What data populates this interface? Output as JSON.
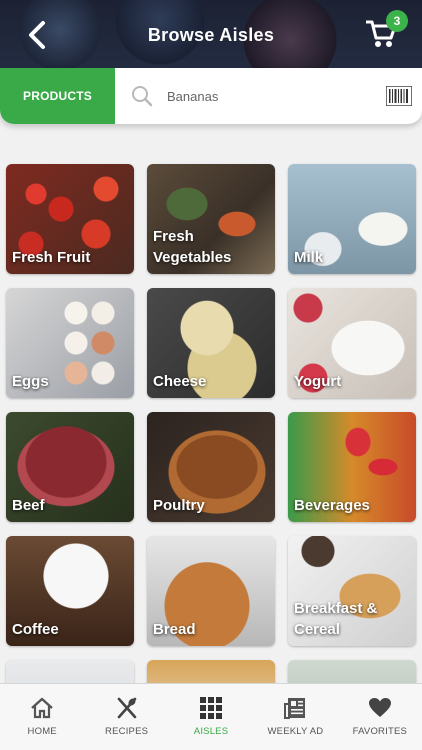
{
  "header": {
    "title": "Browse Aisles",
    "cart_count": "3"
  },
  "search": {
    "mode_label": "PRODUCTS",
    "value": "Bananas"
  },
  "aisles": [
    {
      "label": "Fresh Fruit"
    },
    {
      "label": "Fresh\nVegetables"
    },
    {
      "label": "Milk"
    },
    {
      "label": "Eggs"
    },
    {
      "label": "Cheese"
    },
    {
      "label": "Yogurt"
    },
    {
      "label": "Beef"
    },
    {
      "label": "Poultry"
    },
    {
      "label": "Beverages"
    },
    {
      "label": "Coffee"
    },
    {
      "label": "Bread"
    },
    {
      "label": "Breakfast &\nCereal"
    }
  ],
  "tabs": [
    {
      "label": "HOME",
      "icon": "home-icon"
    },
    {
      "label": "RECIPES",
      "icon": "utensils-icon"
    },
    {
      "label": "AISLES",
      "icon": "grid-icon",
      "active": true
    },
    {
      "label": "WEEKLY AD",
      "icon": "newspaper-icon"
    },
    {
      "label": "FAVORITES",
      "icon": "heart-icon"
    }
  ],
  "colors": {
    "accent": "#3aaa48",
    "badge": "#3cb24a"
  }
}
